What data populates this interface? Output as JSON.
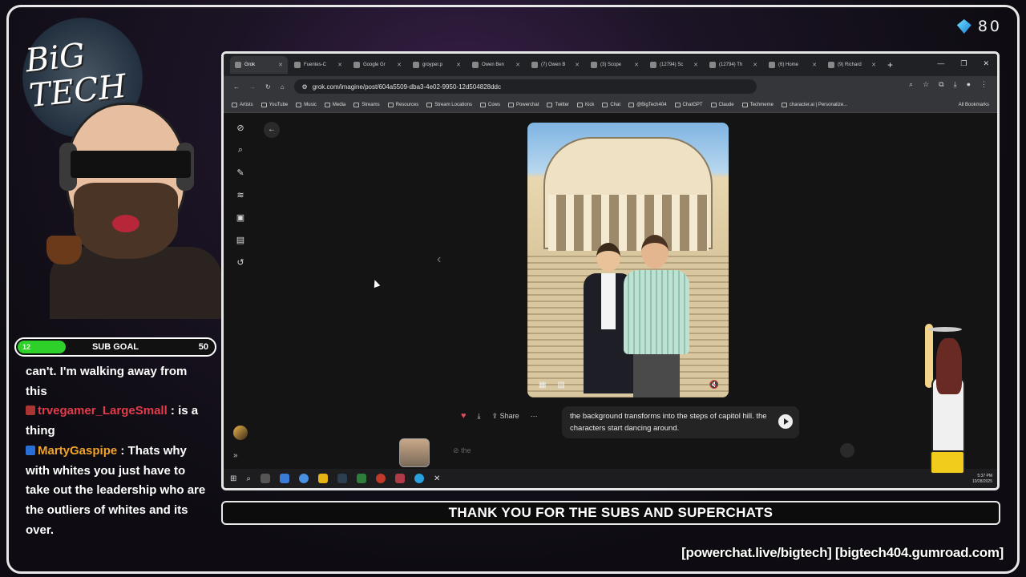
{
  "overlay": {
    "viewer_count": "80",
    "subgoal": {
      "label": "SUB GOAL",
      "current": "12",
      "max": "50",
      "progress": 0.24
    },
    "banner": "THANK YOU FOR THE SUBS AND SUPERCHATS",
    "footer_links": "[powerchat.live/bigtech] [bigtech404.gumroad.com]",
    "logo_text": "BIG TECH"
  },
  "chat": {
    "messages": [
      {
        "user": "",
        "text": "can't. I'm walking away from this"
      },
      {
        "user": "trvegamer_LargeSmall",
        "text": ": is a thing"
      },
      {
        "user": "MartyGaspipe",
        "text": ": Thats why with whites you just have to take out the leadership who are the outliers of whites and its over."
      }
    ]
  },
  "browser": {
    "tabs": [
      {
        "label": "Grok",
        "active": true
      },
      {
        "label": "Fuentes-C"
      },
      {
        "label": "Google Gr"
      },
      {
        "label": "groyper.p"
      },
      {
        "label": "Owen Ben"
      },
      {
        "label": "(7) Owen B"
      },
      {
        "label": "(3) Scope"
      },
      {
        "label": "(12794) Sc"
      },
      {
        "label": "(12794) Th"
      },
      {
        "label": "(6) Home"
      },
      {
        "label": "(9) Richard"
      }
    ],
    "url": "grok.com/imagine/post/604a5509-dba3-4e02-9950-12d504828ddc",
    "bookmarks": [
      "Artists",
      "YouTube",
      "Music",
      "Media",
      "Streams",
      "Resources",
      "Stream Locations",
      "Cows",
      "Powerchat",
      "Twitter",
      "Kick",
      "Chat",
      "@BigTech404",
      "ChatGPT",
      "Claude",
      "Techmeme",
      "character.ai | Personalize..."
    ],
    "all_bookmarks": "All Bookmarks"
  },
  "grok": {
    "actions": {
      "share": "Share"
    },
    "prompt": "the background transforms into the steps of capitol hill. the characters start dancing around.",
    "input_placeholder": "the"
  },
  "taskbar": {
    "time": "5:37 PM",
    "date": "10/28/2025"
  }
}
